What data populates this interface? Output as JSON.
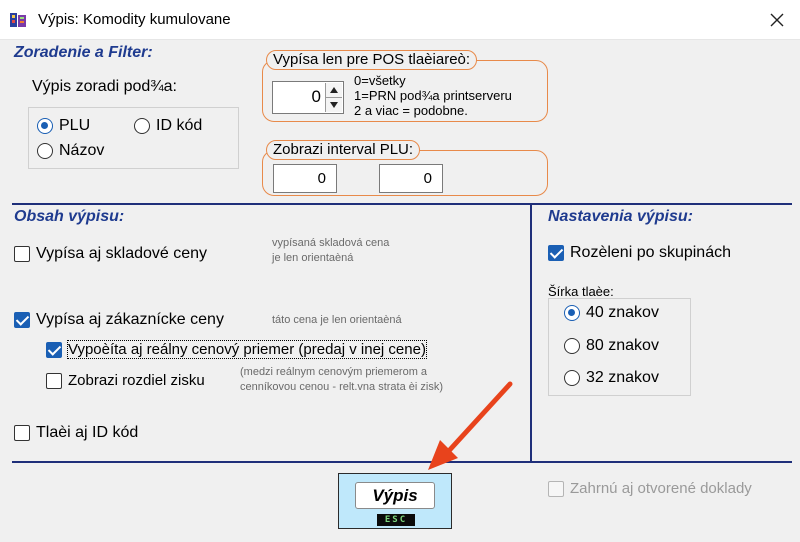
{
  "window": {
    "title": "Výpis: Komodity kumulovane"
  },
  "filter": {
    "section_title": "Zoradenie a Filter:",
    "sort_label": "Výpis zoradi pod¾a:",
    "sort_options": [
      {
        "label": "PLU",
        "selected": true
      },
      {
        "label": "ID kód",
        "selected": false
      },
      {
        "label": "Názov",
        "selected": false
      }
    ]
  },
  "pos": {
    "legend": "Vypísa len pre POS tlaèiareò:",
    "value": "0",
    "note_lines": [
      "0=všetky",
      "1=PRN pod¾a printserveru",
      "2 a viac = podobne."
    ]
  },
  "plu_interval": {
    "legend": "Zobrazi interval PLU:",
    "from": "0",
    "to": "0"
  },
  "content": {
    "section_title": "Obsah výpisu:",
    "stock_prices": {
      "label": "Vypísa aj skladové ceny",
      "checked": false
    },
    "stock_note_lines": [
      "vypísaná skladová cena",
      "je len orientaèná"
    ],
    "customer_prices": {
      "label": "Vypísa aj zákaznícke ceny",
      "checked": true
    },
    "customer_note": "táto cena je len orientaèná",
    "real_average": {
      "label": "Vypoèíta aj reálny cenový priemer (predaj v inej cene)",
      "checked": true
    },
    "profit_diff": {
      "label": "Zobrazi rozdiel zisku",
      "checked": false
    },
    "profit_note_lines": [
      "(medzi reálnym cenovým priemerom a",
      "cenníkovou cenou - relt.vna strata èi zisk)"
    ],
    "print_id": {
      "label": "Tlaèi aj ID kód",
      "checked": false
    }
  },
  "settings": {
    "section_title": "Nastavenia výpisu:",
    "split_groups": {
      "label": "Rozèleni po skupinách",
      "checked": true
    },
    "width_label": "Šírka tlaèe:",
    "width_options": [
      {
        "label": "40 znakov",
        "selected": true
      },
      {
        "label": "80 znakov",
        "selected": false
      },
      {
        "label": "32 znakov",
        "selected": false
      }
    ]
  },
  "footer": {
    "vypis_label": "Výpis",
    "esc_label": "ESC",
    "include_open": {
      "label": "Zahrnú aj otvorené doklady",
      "checked": false,
      "disabled": true
    }
  },
  "colors": {
    "section_title": "#1f3b8f",
    "orange_border": "#e88a4a",
    "accent": "#1a5fb4",
    "divider": "#1f2f7a",
    "vypis_bg": "#bfe8fb",
    "arrow": "#e8431c"
  }
}
